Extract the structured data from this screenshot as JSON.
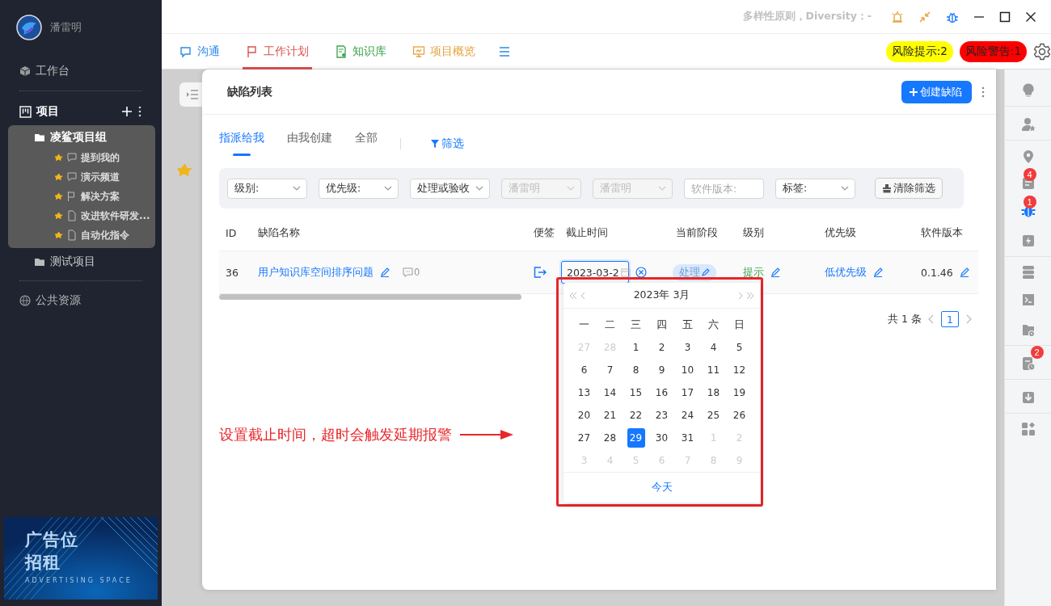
{
  "sidebar": {
    "user": "潘雷明",
    "nav": [
      {
        "label": "工作台"
      }
    ],
    "projects": {
      "label": "项目",
      "groups": [
        {
          "label": "凌鲨项目组",
          "expanded": true,
          "children": [
            {
              "label": "提到我的",
              "kind": "chat",
              "starred": true
            },
            {
              "label": "演示频道",
              "kind": "chat",
              "starred": true
            },
            {
              "label": "解决方案",
              "kind": "flag",
              "starred": true
            },
            {
              "label": "改进软件研发...",
              "kind": "doc",
              "starred": true
            },
            {
              "label": "自动化指令",
              "kind": "doc",
              "starred": true
            }
          ]
        },
        {
          "label": "测试项目",
          "expanded": false
        }
      ]
    },
    "public": {
      "label": "公共资源"
    },
    "ad": {
      "lines": [
        "广告位",
        "招租"
      ],
      "subtitle": "ADVERTISING SPACE"
    }
  },
  "titlebar": {
    "diversity": "多样性原则，Diversity：-"
  },
  "tabs": [
    {
      "label": "沟通",
      "selected": false,
      "color": "#2f8ae8"
    },
    {
      "label": "工作计划",
      "selected": true,
      "color": "#d9534f"
    },
    {
      "label": "知识库",
      "selected": false,
      "color": "#3aa34b"
    },
    {
      "label": "项目概览",
      "selected": false,
      "color": "#e6a23c"
    }
  ],
  "risks": [
    {
      "label": "风险提示:2",
      "color": "#ffff00"
    },
    {
      "label": "风险警告:1",
      "color": "#ff0000"
    }
  ],
  "right_rail": [
    {
      "selected": false
    },
    {
      "selected": false
    },
    {
      "selected": false
    },
    {
      "selected": false,
      "badge": "4"
    },
    {
      "selected": true,
      "badge": "1"
    },
    {
      "selected": false
    },
    {
      "selected": false
    },
    {
      "selected": false
    },
    {
      "selected": false
    },
    {
      "selected": false,
      "badge": "2"
    },
    {
      "selected": false
    },
    {
      "selected": false
    }
  ],
  "panel": {
    "title": "缺陷列表",
    "create_button": "创建缺陷",
    "subtabs": [
      {
        "label": "指派给我",
        "selected": true
      },
      {
        "label": "由我创建",
        "selected": false
      },
      {
        "label": "全部",
        "selected": false
      }
    ],
    "filter_link": "筛选",
    "filters": [
      {
        "kind": "select",
        "value": "级别:",
        "disabled": false
      },
      {
        "kind": "select",
        "value": "优先级:",
        "disabled": false
      },
      {
        "kind": "select",
        "value": "处理或验收",
        "disabled": false
      },
      {
        "kind": "select",
        "value": "潘雷明",
        "disabled": true
      },
      {
        "kind": "select",
        "value": "潘雷明",
        "disabled": true
      },
      {
        "kind": "input",
        "placeholder": "软件版本:"
      },
      {
        "kind": "select",
        "value": "标签:",
        "disabled": false
      }
    ],
    "clear_button": "清除筛选",
    "table": {
      "columns": [
        "ID",
        "缺陷名称",
        "便签",
        "截止时间",
        "当前阶段",
        "级别",
        "优先级",
        "软件版本"
      ],
      "rows": [
        {
          "id": "36",
          "name": "用户知识库空间排序问题",
          "comments": "0",
          "deadline": "2023-03-2",
          "stage": "处理",
          "level": "提示",
          "priority": "低优先级",
          "version": "0.1.46"
        }
      ]
    },
    "pagination": {
      "total": "共 1 条",
      "pages": [
        {
          "label": "1",
          "selected": true
        }
      ]
    }
  },
  "calendar": {
    "header": "2023年 3月",
    "weekdays": [
      "一",
      "二",
      "三",
      "四",
      "五",
      "六",
      "日"
    ],
    "days": [
      {
        "label": "27",
        "in_month": false,
        "selected": false
      },
      {
        "label": "28",
        "in_month": false,
        "selected": false
      },
      {
        "label": "1",
        "in_month": true,
        "selected": false
      },
      {
        "label": "2",
        "in_month": true,
        "selected": false
      },
      {
        "label": "3",
        "in_month": true,
        "selected": false
      },
      {
        "label": "4",
        "in_month": true,
        "selected": false
      },
      {
        "label": "5",
        "in_month": true,
        "selected": false
      },
      {
        "label": "6",
        "in_month": true,
        "selected": false
      },
      {
        "label": "7",
        "in_month": true,
        "selected": false
      },
      {
        "label": "8",
        "in_month": true,
        "selected": false
      },
      {
        "label": "9",
        "in_month": true,
        "selected": false
      },
      {
        "label": "10",
        "in_month": true,
        "selected": false
      },
      {
        "label": "11",
        "in_month": true,
        "selected": false
      },
      {
        "label": "12",
        "in_month": true,
        "selected": false
      },
      {
        "label": "13",
        "in_month": true,
        "selected": false
      },
      {
        "label": "14",
        "in_month": true,
        "selected": false
      },
      {
        "label": "15",
        "in_month": true,
        "selected": false
      },
      {
        "label": "16",
        "in_month": true,
        "selected": false
      },
      {
        "label": "17",
        "in_month": true,
        "selected": false
      },
      {
        "label": "18",
        "in_month": true,
        "selected": false
      },
      {
        "label": "19",
        "in_month": true,
        "selected": false
      },
      {
        "label": "20",
        "in_month": true,
        "selected": false
      },
      {
        "label": "21",
        "in_month": true,
        "selected": false
      },
      {
        "label": "22",
        "in_month": true,
        "selected": false
      },
      {
        "label": "23",
        "in_month": true,
        "selected": false
      },
      {
        "label": "24",
        "in_month": true,
        "selected": false
      },
      {
        "label": "25",
        "in_month": true,
        "selected": false
      },
      {
        "label": "26",
        "in_month": true,
        "selected": false
      },
      {
        "label": "27",
        "in_month": true,
        "selected": false
      },
      {
        "label": "28",
        "in_month": true,
        "selected": false
      },
      {
        "label": "29",
        "in_month": true,
        "selected": true
      },
      {
        "label": "30",
        "in_month": true,
        "selected": false
      },
      {
        "label": "31",
        "in_month": true,
        "selected": false
      },
      {
        "label": "1",
        "in_month": false,
        "selected": false
      },
      {
        "label": "2",
        "in_month": false,
        "selected": false
      },
      {
        "label": "3",
        "in_month": false,
        "selected": false
      },
      {
        "label": "4",
        "in_month": false,
        "selected": false
      },
      {
        "label": "5",
        "in_month": false,
        "selected": false
      },
      {
        "label": "6",
        "in_month": false,
        "selected": false
      },
      {
        "label": "7",
        "in_month": false,
        "selected": false
      },
      {
        "label": "8",
        "in_month": false,
        "selected": false
      },
      {
        "label": "9",
        "in_month": false,
        "selected": false
      }
    ],
    "today": "今天"
  },
  "annotation": {
    "text": "设置截止时间，超时会触发延期报警"
  }
}
